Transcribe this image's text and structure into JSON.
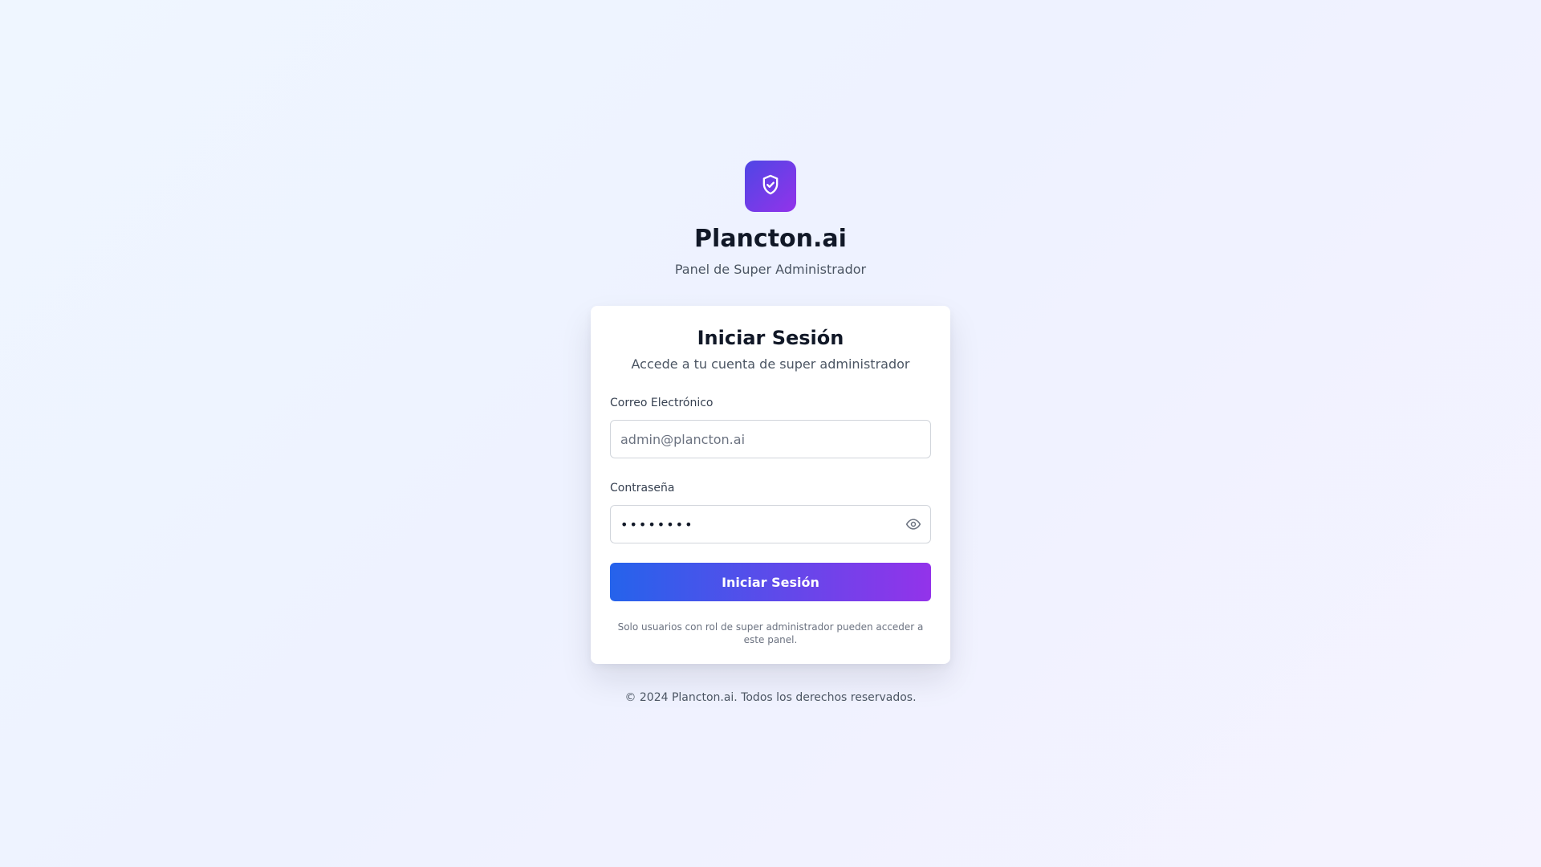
{
  "brand": {
    "logo_icon": "shield-check-icon",
    "title": "Plancton.ai",
    "subtitle": "Panel de Super Administrador"
  },
  "login_card": {
    "title": "Iniciar Sesión",
    "subtitle": "Accede a tu cuenta de super administrador",
    "email": {
      "label": "Correo Electrónico",
      "value": "",
      "placeholder": "admin@plancton.ai"
    },
    "password": {
      "label": "Contraseña",
      "value": "••••••••",
      "toggle_icon": "eye-icon"
    },
    "submit_label": "Iniciar Sesión",
    "note": "Solo usuarios con rol de super administrador pueden acceder a este panel."
  },
  "footer": {
    "text": "© 2024 Plancton.ai. Todos los derechos reservados."
  },
  "colors": {
    "accent_start": "#2563eb",
    "accent_end": "#9333ea",
    "logo_start": "#4f46e5",
    "logo_end": "#9333ea"
  }
}
